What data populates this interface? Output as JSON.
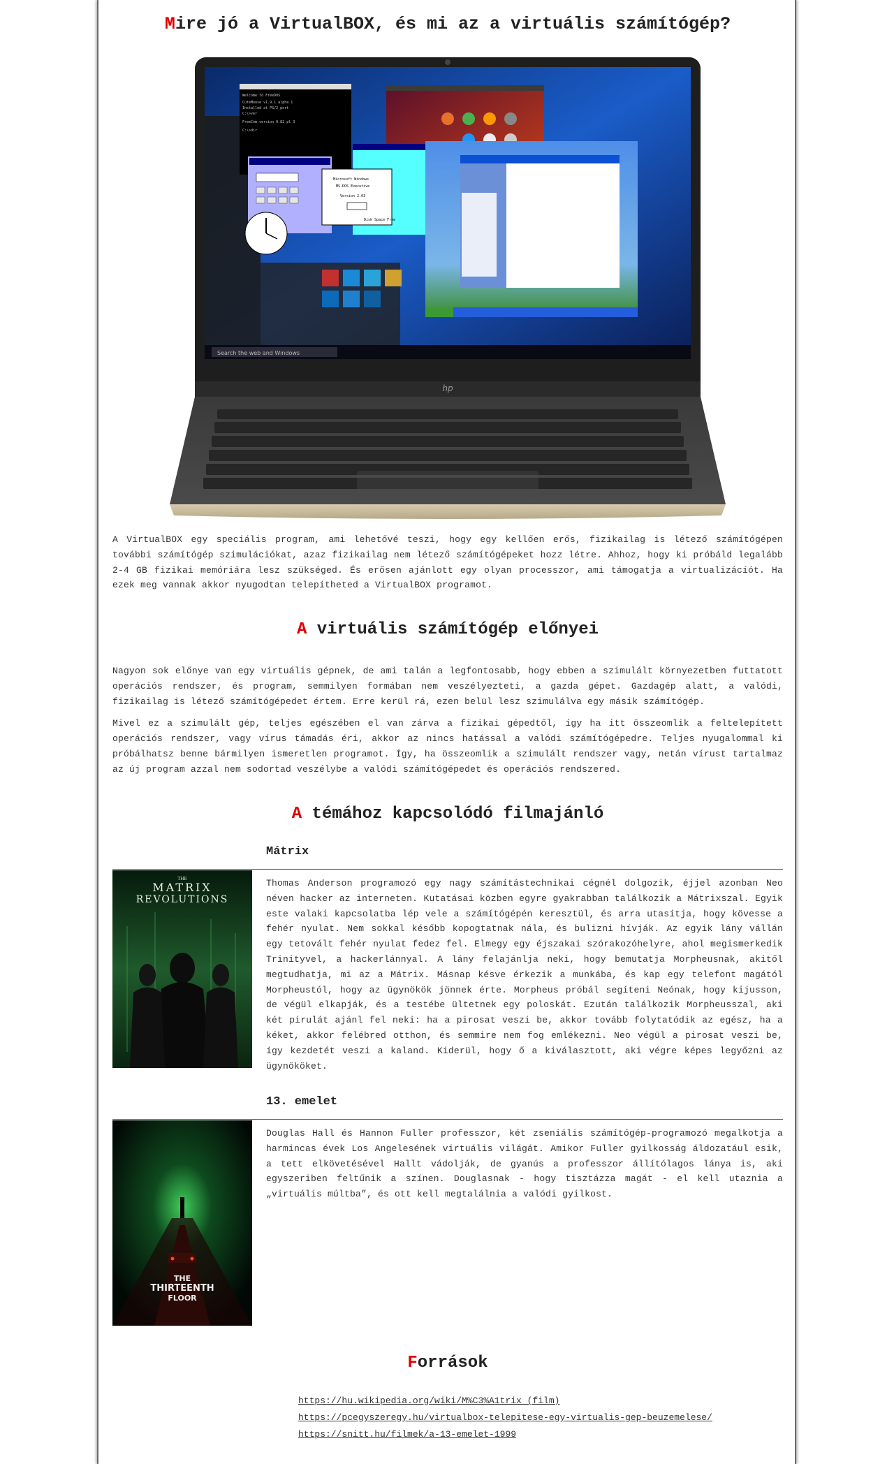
{
  "page": {
    "title_first": "M",
    "title_rest": "ire jó a VirtualBOX, és mi az a virtuális számítógép?",
    "laptop_brand": "hp",
    "laptop_search_placeholder": "Search the web and Windows",
    "intro": "A VirtualBOX egy speciális program, ami lehetővé teszi, hogy egy kellően erős, fizikailag is létező számítógépen további számítógép szimulációkat, azaz fizikailag nem létező számítógépeket hozz létre. Ahhoz, hogy ki próbáld legalább 2-4 GB fizikai memóriára lesz szükséged. És erősen ajánlott egy olyan processzor, ami támogatja a virtualizációt. Ha ezek meg vannak akkor nyugodtan telepítheted a VirtualBOX programot."
  },
  "advantages": {
    "heading_first": "A",
    "heading_rest": " virtuális számítógép előnyei",
    "p1": "Nagyon sok előnye van egy virtuális gépnek, de ami talán a legfontosabb, hogy ebben a szimulált környezetben futtatott operációs rendszer, és program, semmilyen formában nem veszélyezteti, a gazda gépet. Gazdagép alatt, a valódi, fizikailag is létező számítógépedet értem. Erre kerül rá, ezen belül lesz szimulálva egy másik számítógép.",
    "p2": "Mivel ez a szimulált gép, teljes egészében el van zárva a fizikai gépedtől, így ha itt összeomlik a feltelepített operációs rendszer, vagy vírus támadás éri, akkor az nincs hatással a valódi számítógépedre. Teljes nyugalommal ki próbálhatsz benne bármilyen ismeretlen programot. Így, ha összeomlik a szimulált rendszer vagy, netán vírust tartalmaz az új program azzal nem sodortad veszélybe a valódi számítógépedet és operációs rendszered."
  },
  "films": {
    "heading_first": "A",
    "heading_rest": " témához kapcsolódó filmajánló",
    "matrix": {
      "title": "Mátrix",
      "poster_title_line1": "THE",
      "poster_title_line2": "MATRIX",
      "poster_title_line3": "REVOLUTIONS",
      "description": "Thomas Anderson programozó egy nagy számítástechnikai cégnél dolgozik, éjjel azonban Neo néven hacker az interneten. Kutatásai közben egyre gyakrabban találkozik a Mátrixszal. Egyik este valaki kapcsolatba lép vele a számítógépén keresztül, és arra utasítja, hogy kövesse a fehér nyulat. Nem sokkal később kopogtatnak nála, és bulizni hívják. Az egyik lány vállán egy tetovált fehér nyulat fedez fel. Elmegy egy éjszakai szórakozóhelyre, ahol megismerkedik Trinityvel, a hackerlánnyal. A lány felajánlja neki, hogy bemutatja Morpheusnak, akitől megtudhatja, mi az a Mátrix. Másnap késve érkezik a munkába, és kap egy telefont magától Morpheustól, hogy az ügynökök jönnek érte. Morpheus próbál segíteni Neónak, hogy kijusson, de végül elkapják, és a testébe ültetnek egy poloskát. Ezután találkozik Morpheusszal, aki két pirulát ajánl fel neki: ha a pirosat veszi be, akkor tovább folytatódik az egész, ha a kéket, akkor felébred otthon, és semmire nem fog emlékezni. Neo végül a pirosat veszi be, így kezdetét veszi a kaland. Kiderül, hogy ő a kiválasztott, aki végre képes legyőzni az ügynököket."
    },
    "floor13": {
      "title": "13. emelet",
      "poster_title_line1": "THE",
      "poster_title_line2": "THIRTEENTH",
      "poster_title_line3": "FLOOR",
      "description": "Douglas Hall és Hannon Fuller professzor, két zseniális számítógép-programozó megalkotja a harmincas évek Los Angelesének virtuális világát. Amikor Fuller gyilkosság áldozatául esik, a tett elkövetésével Hallt vádolják, de gyanús a professzor állítólagos lánya is, aki egyszeriben feltűnik a színen. Douglasnak - hogy tisztázza magát - el kell utaznia a „virtuális múltba”, és ott kell megtalálnia a valódi gyilkost."
    }
  },
  "sources": {
    "heading_first": "F",
    "heading_rest": "orrások",
    "links": [
      "https://hu.wikipedia.org/wiki/M%C3%A1trix_(film)",
      "https://pcegyszeregy.hu/virtualbox-telepitese-egy-virtualis-gep-beuzemelese/",
      "https://snitt.hu/filmek/a-13-emelet-1999"
    ]
  },
  "colors": {
    "accent": "#e00000",
    "text": "#333333",
    "border": "#6a6a6a"
  }
}
